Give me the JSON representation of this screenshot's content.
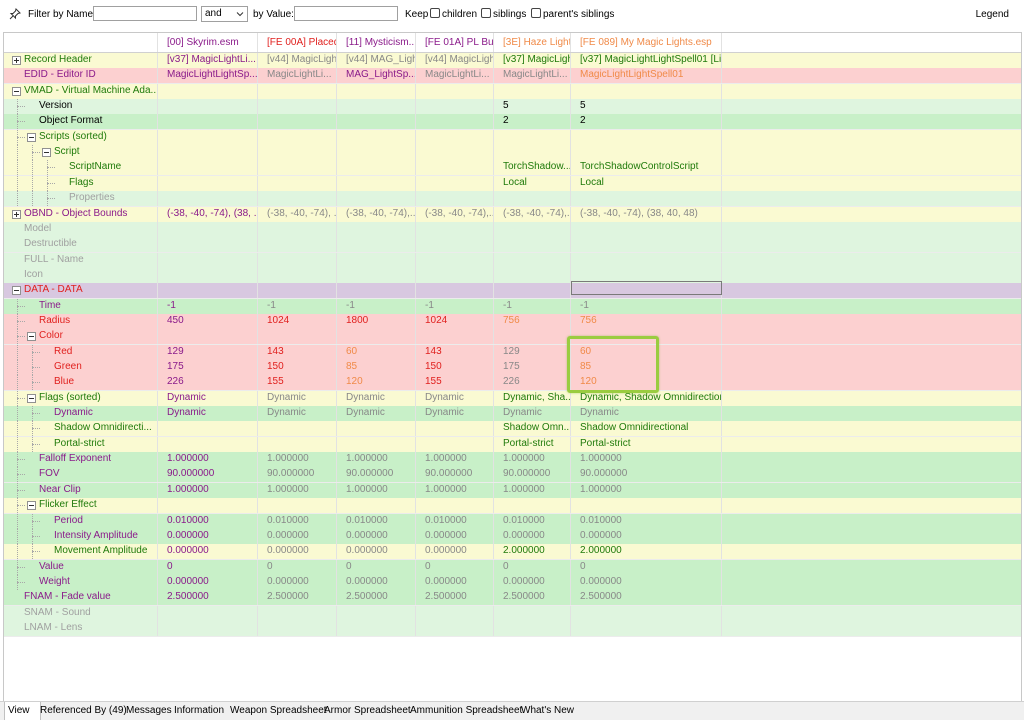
{
  "filter_bar": {
    "filter_by_name_label": "Filter by Name:",
    "name_value": "",
    "operator_value": "and",
    "by_value_label": "by Value:",
    "value_value": "",
    "keep_label": "Keep",
    "children_label": "children",
    "siblings_label": "siblings",
    "parents_siblings_label": "parent's siblings",
    "legend_label": "Legend"
  },
  "columns": [
    {
      "header": "[00] Skyrim.esm",
      "color": "#8a1a8a"
    },
    {
      "header": "[FE 00A] Placed...",
      "color": "#e0201e"
    },
    {
      "header": "[11] Mysticism...",
      "color": "#8a1a8a"
    },
    {
      "header": "[FE 01A] PL Bul...",
      "color": "#8a1a8a"
    },
    {
      "header": "[3E] Haze Light...",
      "color": "#f08a48"
    },
    {
      "header": "[FE 089] My Magic Lights.esp",
      "color": "#f08a48"
    }
  ],
  "rows": [
    {
      "label": "Record Header",
      "indent": 0,
      "expander": "plus",
      "bg": "#fafad2",
      "lc": "c-green",
      "vals": [
        "[v37] MagicLightLi...",
        "[v44] MagicLightLi...",
        "[v44] MAG_LightSp...",
        "[v44] MagicLightLi...",
        "[v37] MagicLightLi...",
        "[v37] MagicLightLightSpell01 [Li..."
      ],
      "vc": [
        "c-purple",
        "c-gray",
        "c-gray",
        "c-gray",
        "c-green",
        "c-green"
      ]
    },
    {
      "label": "EDID - Editor ID",
      "indent": 0,
      "expander": "none",
      "bg": "#fcd0d0",
      "lc": "c-purple",
      "vals": [
        "MagicLightLightSp...",
        "MagicLightLi...",
        "MAG_LightSp...",
        "MagicLightLi...",
        "MagicLightLi...",
        "MagicLightLightSpell01"
      ],
      "vc": [
        "c-purple",
        "c-gray",
        "c-purple",
        "c-gray",
        "c-gray",
        "c-orange"
      ]
    },
    {
      "label": "VMAD - Virtual Machine Ada...",
      "indent": 0,
      "expander": "minus",
      "bg": "#fafad2",
      "lc": "c-green",
      "vals": [
        "",
        "",
        "",
        "",
        "",
        ""
      ],
      "vc": [
        "",
        "",
        "",
        "",
        "",
        ""
      ]
    },
    {
      "label": "Version",
      "indent": 1,
      "expander": "none",
      "bg": "#dff5df",
      "lc": "c-black",
      "vals": [
        "",
        "",
        "",
        "",
        "5",
        "5"
      ],
      "vc": [
        "",
        "",
        "",
        "",
        "c-black",
        "c-black"
      ]
    },
    {
      "label": "Object Format",
      "indent": 1,
      "expander": "none",
      "bg": "#c8f0c8",
      "lc": "c-black",
      "vals": [
        "",
        "",
        "",
        "",
        "2",
        "2"
      ],
      "vc": [
        "",
        "",
        "",
        "",
        "c-black",
        "c-black"
      ]
    },
    {
      "label": "Scripts (sorted)",
      "indent": 1,
      "expander": "minus",
      "bg": "#fafad2",
      "lc": "c-green",
      "vals": [
        "",
        "",
        "",
        "",
        "",
        ""
      ],
      "vc": [
        "",
        "",
        "",
        "",
        "",
        ""
      ]
    },
    {
      "label": "Script",
      "indent": 2,
      "expander": "minus",
      "bg": "#fafad2",
      "lc": "c-green",
      "vals": [
        "",
        "",
        "",
        "",
        "",
        ""
      ],
      "vc": [
        "",
        "",
        "",
        "",
        "",
        ""
      ]
    },
    {
      "label": "ScriptName",
      "indent": 3,
      "expander": "none",
      "bg": "#fafad2",
      "lc": "c-green",
      "vals": [
        "",
        "",
        "",
        "",
        "TorchShadow...",
        "TorchShadowControlScript"
      ],
      "vc": [
        "",
        "",
        "",
        "",
        "c-green",
        "c-green"
      ]
    },
    {
      "label": "Flags",
      "indent": 3,
      "expander": "none",
      "bg": "#fafad2",
      "lc": "c-green",
      "vals": [
        "",
        "",
        "",
        "",
        "Local",
        "Local"
      ],
      "vc": [
        "",
        "",
        "",
        "",
        "c-green",
        "c-green"
      ]
    },
    {
      "label": "Properties",
      "indent": 3,
      "expander": "none",
      "bg": "#dff5df",
      "lc": "c-lgray",
      "vals": [
        "",
        "",
        "",
        "",
        "",
        ""
      ],
      "vc": [
        "",
        "",
        "",
        "",
        "",
        ""
      ]
    },
    {
      "label": "OBND - Object Bounds",
      "indent": 0,
      "expander": "plus",
      "bg": "#fafad2",
      "lc": "c-purple",
      "vals": [
        "(-38, -40, -74), (38, ...",
        "(-38, -40, -74), ...",
        "(-38, -40, -74),...",
        "(-38, -40, -74),...",
        "(-38, -40, -74),...",
        "(-38, -40, -74), (38, 40, 48)"
      ],
      "vc": [
        "c-purple",
        "c-gray",
        "c-gray",
        "c-gray",
        "c-gray",
        "c-gray"
      ]
    },
    {
      "label": "Model",
      "indent": 0,
      "expander": "none",
      "bg": "#dff5df",
      "lc": "c-lgray",
      "vals": [
        "",
        "",
        "",
        "",
        "",
        ""
      ],
      "vc": [
        "",
        "",
        "",
        "",
        "",
        ""
      ]
    },
    {
      "label": "Destructible",
      "indent": 0,
      "expander": "none",
      "bg": "#dff5df",
      "lc": "c-lgray",
      "vals": [
        "",
        "",
        "",
        "",
        "",
        ""
      ],
      "vc": [
        "",
        "",
        "",
        "",
        "",
        ""
      ]
    },
    {
      "label": "FULL - Name",
      "indent": 0,
      "expander": "none",
      "bg": "#dff5df",
      "lc": "c-lgray",
      "vals": [
        "",
        "",
        "",
        "",
        "",
        ""
      ],
      "vc": [
        "",
        "",
        "",
        "",
        "",
        ""
      ]
    },
    {
      "label": "Icon",
      "indent": 0,
      "expander": "none",
      "bg": "#dff5df",
      "lc": "c-lgray",
      "vals": [
        "",
        "",
        "",
        "",
        "",
        ""
      ],
      "vc": [
        "",
        "",
        "",
        "",
        "",
        ""
      ]
    },
    {
      "label": "DATA - DATA",
      "indent": 0,
      "expander": "minus",
      "bg": "#d8c8e0",
      "lc": "c-red",
      "vals": [
        "",
        "",
        "",
        "",
        "",
        ""
      ],
      "vc": [
        "",
        "",
        "",
        "",
        "",
        ""
      ]
    },
    {
      "label": "Time",
      "indent": 1,
      "expander": "none",
      "bg": "#c8f0c8",
      "lc": "c-purple",
      "vals": [
        "-1",
        "-1",
        "-1",
        "-1",
        "-1",
        "-1"
      ],
      "vc": [
        "c-purple",
        "c-gray",
        "c-gray",
        "c-gray",
        "c-gray",
        "c-gray"
      ]
    },
    {
      "label": "Radius",
      "indent": 1,
      "expander": "none",
      "bg": "#fcd0d0",
      "lc": "c-red",
      "vals": [
        "450",
        "1024",
        "1800",
        "1024",
        "756",
        "756"
      ],
      "vc": [
        "c-purple",
        "c-red",
        "c-red",
        "c-red",
        "c-orange",
        "c-orange"
      ]
    },
    {
      "label": "Color",
      "indent": 1,
      "expander": "minus",
      "bg": "#fcd0d0",
      "lc": "c-red",
      "vals": [
        "",
        "",
        "",
        "",
        "",
        ""
      ],
      "vc": [
        "",
        "",
        "",
        "",
        "",
        ""
      ]
    },
    {
      "label": "Red",
      "indent": 2,
      "expander": "none",
      "bg": "#fcd0d0",
      "lc": "c-red",
      "vals": [
        "129",
        "143",
        "60",
        "143",
        "129",
        "60"
      ],
      "vc": [
        "c-purple",
        "c-red",
        "c-orange",
        "c-red",
        "c-gray",
        "c-orange"
      ]
    },
    {
      "label": "Green",
      "indent": 2,
      "expander": "none",
      "bg": "#fcd0d0",
      "lc": "c-red",
      "vals": [
        "175",
        "150",
        "85",
        "150",
        "175",
        "85"
      ],
      "vc": [
        "c-purple",
        "c-red",
        "c-orange",
        "c-red",
        "c-gray",
        "c-orange"
      ]
    },
    {
      "label": "Blue",
      "indent": 2,
      "expander": "none",
      "bg": "#fcd0d0",
      "lc": "c-red",
      "vals": [
        "226",
        "155",
        "120",
        "155",
        "226",
        "120"
      ],
      "vc": [
        "c-purple",
        "c-red",
        "c-orange",
        "c-red",
        "c-gray",
        "c-orange"
      ]
    },
    {
      "label": "Flags (sorted)",
      "indent": 1,
      "expander": "minus",
      "bg": "#fafad2",
      "lc": "c-green",
      "vals": [
        "Dynamic",
        "Dynamic",
        "Dynamic",
        "Dynamic",
        "Dynamic, Sha...",
        "Dynamic, Shadow Omnidirection..."
      ],
      "vc": [
        "c-purple",
        "c-gray",
        "c-gray",
        "c-gray",
        "c-green",
        "c-green"
      ]
    },
    {
      "label": "Dynamic",
      "indent": 2,
      "expander": "none",
      "bg": "#c8f0c8",
      "lc": "c-purple",
      "vals": [
        "Dynamic",
        "Dynamic",
        "Dynamic",
        "Dynamic",
        "Dynamic",
        "Dynamic"
      ],
      "vc": [
        "c-purple",
        "c-gray",
        "c-gray",
        "c-gray",
        "c-gray",
        "c-gray"
      ]
    },
    {
      "label": "Shadow Omnidirecti...",
      "indent": 2,
      "expander": "none",
      "bg": "#fafad2",
      "lc": "c-green",
      "vals": [
        "",
        "",
        "",
        "",
        "Shadow Omn...",
        "Shadow Omnidirectional"
      ],
      "vc": [
        "",
        "",
        "",
        "",
        "c-green",
        "c-green"
      ]
    },
    {
      "label": "Portal-strict",
      "indent": 2,
      "expander": "none",
      "bg": "#fafad2",
      "lc": "c-green",
      "vals": [
        "",
        "",
        "",
        "",
        "Portal-strict",
        "Portal-strict"
      ],
      "vc": [
        "",
        "",
        "",
        "",
        "c-green",
        "c-green"
      ]
    },
    {
      "label": "Falloff Exponent",
      "indent": 1,
      "expander": "none",
      "bg": "#c8f0c8",
      "lc": "c-purple",
      "vals": [
        "1.000000",
        "1.000000",
        "1.000000",
        "1.000000",
        "1.000000",
        "1.000000"
      ],
      "vc": [
        "c-purple",
        "c-gray",
        "c-gray",
        "c-gray",
        "c-gray",
        "c-gray"
      ]
    },
    {
      "label": "FOV",
      "indent": 1,
      "expander": "none",
      "bg": "#c8f0c8",
      "lc": "c-purple",
      "vals": [
        "90.000000",
        "90.000000",
        "90.000000",
        "90.000000",
        "90.000000",
        "90.000000"
      ],
      "vc": [
        "c-purple",
        "c-gray",
        "c-gray",
        "c-gray",
        "c-gray",
        "c-gray"
      ]
    },
    {
      "label": "Near Clip",
      "indent": 1,
      "expander": "none",
      "bg": "#c8f0c8",
      "lc": "c-purple",
      "vals": [
        "1.000000",
        "1.000000",
        "1.000000",
        "1.000000",
        "1.000000",
        "1.000000"
      ],
      "vc": [
        "c-purple",
        "c-gray",
        "c-gray",
        "c-gray",
        "c-gray",
        "c-gray"
      ]
    },
    {
      "label": "Flicker Effect",
      "indent": 1,
      "expander": "minus",
      "bg": "#fafad2",
      "lc": "c-green",
      "vals": [
        "",
        "",
        "",
        "",
        "",
        ""
      ],
      "vc": [
        "",
        "",
        "",
        "",
        "",
        ""
      ]
    },
    {
      "label": "Period",
      "indent": 2,
      "expander": "none",
      "bg": "#c8f0c8",
      "lc": "c-purple",
      "vals": [
        "0.010000",
        "0.010000",
        "0.010000",
        "0.010000",
        "0.010000",
        "0.010000"
      ],
      "vc": [
        "c-purple",
        "c-gray",
        "c-gray",
        "c-gray",
        "c-gray",
        "c-gray"
      ]
    },
    {
      "label": "Intensity Amplitude",
      "indent": 2,
      "expander": "none",
      "bg": "#c8f0c8",
      "lc": "c-purple",
      "vals": [
        "0.000000",
        "0.000000",
        "0.000000",
        "0.000000",
        "0.000000",
        "0.000000"
      ],
      "vc": [
        "c-purple",
        "c-gray",
        "c-gray",
        "c-gray",
        "c-gray",
        "c-gray"
      ]
    },
    {
      "label": "Movement Amplitude",
      "indent": 2,
      "expander": "none",
      "bg": "#fafad2",
      "lc": "c-green",
      "vals": [
        "0.000000",
        "0.000000",
        "0.000000",
        "0.000000",
        "2.000000",
        "2.000000"
      ],
      "vc": [
        "c-purple",
        "c-gray",
        "c-gray",
        "c-gray",
        "c-green",
        "c-green"
      ]
    },
    {
      "label": "Value",
      "indent": 1,
      "expander": "none",
      "bg": "#c8f0c8",
      "lc": "c-purple",
      "vals": [
        "0",
        "0",
        "0",
        "0",
        "0",
        "0"
      ],
      "vc": [
        "c-purple",
        "c-gray",
        "c-gray",
        "c-gray",
        "c-gray",
        "c-gray"
      ]
    },
    {
      "label": "Weight",
      "indent": 1,
      "expander": "none",
      "bg": "#c8f0c8",
      "lc": "c-purple",
      "vals": [
        "0.000000",
        "0.000000",
        "0.000000",
        "0.000000",
        "0.000000",
        "0.000000"
      ],
      "vc": [
        "c-purple",
        "c-gray",
        "c-gray",
        "c-gray",
        "c-gray",
        "c-gray"
      ]
    },
    {
      "label": "FNAM - Fade value",
      "indent": 0,
      "expander": "none",
      "bg": "#c8f0c8",
      "lc": "c-purple",
      "vals": [
        "2.500000",
        "2.500000",
        "2.500000",
        "2.500000",
        "2.500000",
        "2.500000"
      ],
      "vc": [
        "c-purple",
        "c-gray",
        "c-gray",
        "c-gray",
        "c-gray",
        "c-gray"
      ]
    },
    {
      "label": "SNAM - Sound",
      "indent": 0,
      "expander": "none",
      "bg": "#dff5df",
      "lc": "c-lgray",
      "vals": [
        "",
        "",
        "",
        "",
        "",
        ""
      ],
      "vc": [
        "",
        "",
        "",
        "",
        "",
        ""
      ]
    },
    {
      "label": "LNAM - Lens",
      "indent": 0,
      "expander": "none",
      "bg": "#dff5df",
      "lc": "c-lgray",
      "vals": [
        "",
        "",
        "",
        "",
        "",
        ""
      ],
      "vc": [
        "",
        "",
        "",
        "",
        "",
        ""
      ]
    }
  ],
  "tabs": [
    "View",
    "Referenced By (49)",
    "Messages",
    "Information",
    "Weapon Spreadsheet",
    "Armor Spreadsheet",
    "Ammunition Spreadsheet",
    "What's New"
  ],
  "active_tab": "View",
  "colors": {
    "highlight_box": "#9acc40",
    "row_yellow": "#fafad2",
    "row_green": "#c8f0c8",
    "row_red": "#fcd0d0",
    "row_purple": "#d8c8e0"
  }
}
